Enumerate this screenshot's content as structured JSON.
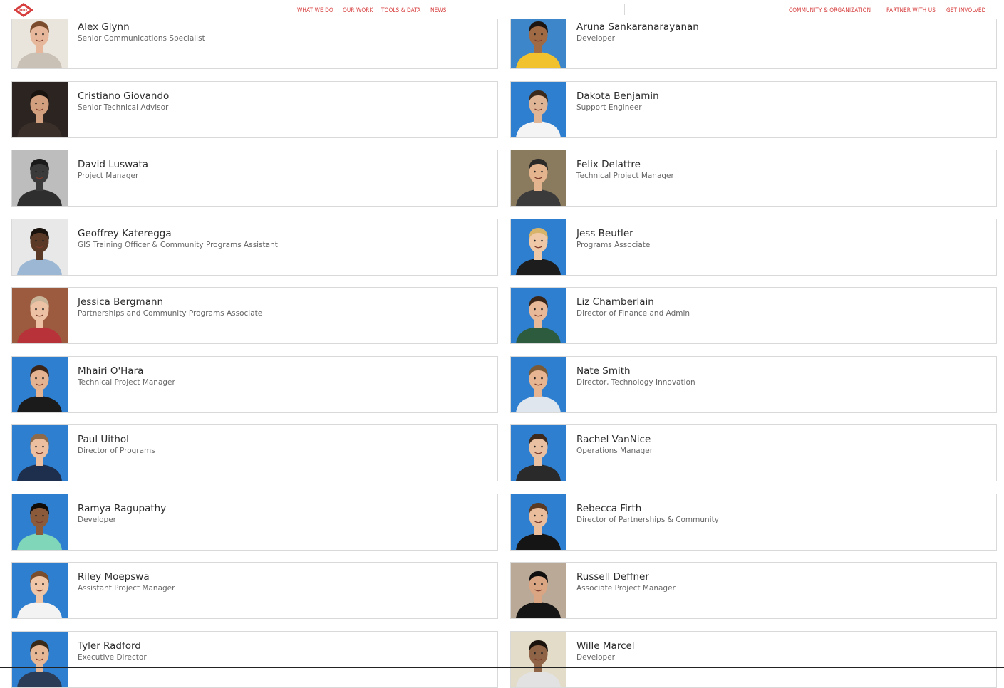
{
  "brand": {
    "logo_text": "HOT",
    "accent": "#d73f3f"
  },
  "nav": {
    "left": [
      "WHAT WE DO",
      "OUR WORK",
      "TOOLS & DATA",
      "NEWS"
    ],
    "right": [
      "COMMUNITY & ORGANIZATION",
      "PARTNER WITH US",
      "GET INVOLVED"
    ]
  },
  "team": [
    {
      "name": "Alex Glynn",
      "role": "Senior Communications Specialist",
      "photo": {
        "bg": "#e9e4dc",
        "skin": "#e6b79a",
        "hair": "#7a4b2c",
        "shirt": "#c9c1b6"
      }
    },
    {
      "name": "Aruna Sankaranarayanan",
      "role": "Developer",
      "photo": {
        "bg": "#3d86c9",
        "skin": "#a06a45",
        "hair": "#1c1410",
        "shirt": "#f2c12e"
      }
    },
    {
      "name": "Cristiano Giovando",
      "role": "Senior Technical Advisor",
      "photo": {
        "bg": "#2b2420",
        "skin": "#d2a07e",
        "hair": "#1a1410",
        "shirt": "#3a2f29"
      }
    },
    {
      "name": "Dakota Benjamin",
      "role": "Support Engineer",
      "photo": {
        "bg": "#2f7fd0",
        "skin": "#e0b596",
        "hair": "#3b2a1c",
        "shirt": "#f4f4f4"
      }
    },
    {
      "name": "David Luswata",
      "role": "Project Manager",
      "photo": {
        "bg": "#bdbdbd",
        "skin": "#3a3a3a",
        "hair": "#1a1a1a",
        "shirt": "#2e2e2e"
      }
    },
    {
      "name": "Felix Delattre",
      "role": "Technical Project Manager",
      "photo": {
        "bg": "#8a7a5e",
        "skin": "#e4b48e",
        "hair": "#2c2a28",
        "shirt": "#3b3b3b"
      }
    },
    {
      "name": "Geoffrey Kateregga",
      "role": "GIS Training Officer & Community Programs Assistant",
      "photo": {
        "bg": "#e8e8e8",
        "skin": "#5a3a26",
        "hair": "#1a120c",
        "shirt": "#9bb7d4"
      }
    },
    {
      "name": "Jess Beutler",
      "role": "Programs Associate",
      "photo": {
        "bg": "#2f7fd0",
        "skin": "#efc8a8",
        "hair": "#d8b36a",
        "shirt": "#1d1d1d"
      }
    },
    {
      "name": "Jessica Bergmann",
      "role": "Partnerships and Community Programs Associate",
      "photo": {
        "bg": "#9c5a3e",
        "skin": "#edc2a4",
        "hair": "#c9b59a",
        "shirt": "#b8323a"
      }
    },
    {
      "name": "Liz Chamberlain",
      "role": "Director of Finance and Admin",
      "photo": {
        "bg": "#2f7fd0",
        "skin": "#e8b999",
        "hair": "#3a2618",
        "shirt": "#2c5b3e"
      }
    },
    {
      "name": "Mhairi O'Hara",
      "role": "Technical Project Manager",
      "photo": {
        "bg": "#2f7fd0",
        "skin": "#e4b391",
        "hair": "#3b2518",
        "shirt": "#1b1b1b"
      }
    },
    {
      "name": "Nate Smith",
      "role": "Director, Technology Innovation",
      "photo": {
        "bg": "#2f7fd0",
        "skin": "#e7b592",
        "hair": "#7a5a36",
        "shirt": "#dfe6ee"
      }
    },
    {
      "name": "Paul Uithol",
      "role": "Director of Programs",
      "photo": {
        "bg": "#2f7fd0",
        "skin": "#ecbfa0",
        "hair": "#8d6a4a",
        "shirt": "#1d2f4d"
      }
    },
    {
      "name": "Rachel VanNice",
      "role": "Operations Manager",
      "photo": {
        "bg": "#2f7fd0",
        "skin": "#eac0a2",
        "hair": "#3e2a1c",
        "shirt": "#2a2a2a"
      }
    },
    {
      "name": "Ramya Ragupathy",
      "role": "Developer",
      "photo": {
        "bg": "#2f7fd0",
        "skin": "#8a5a3a",
        "hair": "#120c08",
        "shirt": "#7fd6b9"
      }
    },
    {
      "name": "Rebecca Firth",
      "role": "Director of Partnerships & Community",
      "photo": {
        "bg": "#2f7fd0",
        "skin": "#eabd9c",
        "hair": "#5a3a22",
        "shirt": "#151515"
      }
    },
    {
      "name": "Riley Moepswa",
      "role": "Assistant Project Manager",
      "photo": {
        "bg": "#2f7fd0",
        "skin": "#efc7a8",
        "hair": "#7a4e2c",
        "shirt": "#f3f3f3"
      }
    },
    {
      "name": "Russell Deffner",
      "role": "Associate Project Manager",
      "photo": {
        "bg": "#b9a996",
        "skin": "#d9a582",
        "hair": "#0f0f0f",
        "shirt": "#151515"
      }
    },
    {
      "name": "Tyler Radford",
      "role": "Executive Director",
      "photo": {
        "bg": "#2f7fd0",
        "skin": "#e7b896",
        "hair": "#3a2a1a",
        "shirt": "#2b3c57"
      }
    },
    {
      "name": "Wille Marcel",
      "role": "Developer",
      "photo": {
        "bg": "#e3dcc8",
        "skin": "#8f6446",
        "hair": "#1a120c",
        "shirt": "#e2e2e2"
      }
    }
  ]
}
